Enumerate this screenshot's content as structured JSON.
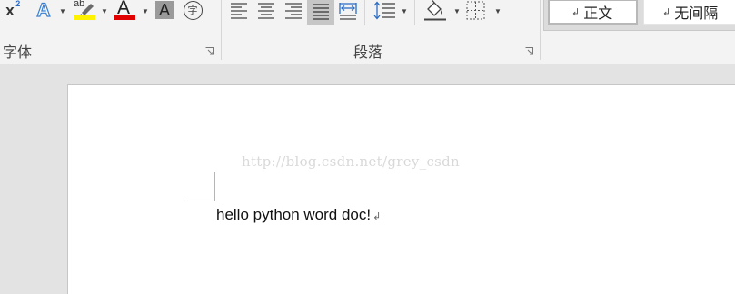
{
  "ribbon": {
    "font_group": {
      "label": "字体",
      "superscript_base": "x",
      "superscript_exp": "2",
      "text_effects_glyph": "A",
      "highlight_glyph": "ab",
      "highlight_color": "#fff200",
      "font_color_glyph": "A",
      "font_color": "#e00000",
      "char_shading_glyph": "A",
      "enclose_glyph": "字"
    },
    "paragraph_group": {
      "label": "段落"
    },
    "styles": {
      "items": [
        {
          "mark": "↲",
          "label": "正文"
        },
        {
          "mark": "↲",
          "label": "无间隔"
        }
      ]
    }
  },
  "document": {
    "watermark": "http://blog.csdn.net/grey_csdn",
    "body_text": "hello python word doc!",
    "paragraph_mark": "↲"
  }
}
